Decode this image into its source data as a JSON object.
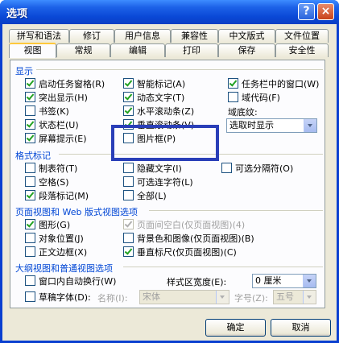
{
  "window": {
    "title": "选项",
    "help_label": "?",
    "close_label": "×"
  },
  "tabs_row1": [
    "拼写和语法",
    "修订",
    "用户信息",
    "兼容性",
    "中文版式",
    "文件位置"
  ],
  "tabs_row2": [
    "视图",
    "常规",
    "编辑",
    "打印",
    "保存",
    "安全性"
  ],
  "active_tab": "视图",
  "display": {
    "title": "显示",
    "items": [
      {
        "label": "启动任务窗格(R)",
        "checked": true
      },
      {
        "label": "智能标记(A)",
        "checked": true
      },
      {
        "label": "任务栏中的窗口(W)",
        "checked": true
      },
      {
        "label": "突出显示(H)",
        "checked": true
      },
      {
        "label": "动态文字(T)",
        "checked": true
      },
      {
        "label": "域代码(F)",
        "checked": false
      },
      {
        "label": "书签(K)",
        "checked": false
      },
      {
        "label": "水平滚动条(Z)",
        "checked": true
      },
      {
        "label": "状态栏(U)",
        "checked": true
      },
      {
        "label": "垂直滚动条(V)",
        "checked": true
      },
      {
        "label": "屏幕提示(E)",
        "checked": true
      },
      {
        "label": "图片框(P)",
        "checked": false
      }
    ],
    "field_shading_label": "域底纹:",
    "field_shading_value": "选取时显示"
  },
  "format": {
    "title": "格式标记",
    "items": [
      {
        "label": "制表符(T)",
        "checked": false
      },
      {
        "label": "隐藏文字(I)",
        "checked": false
      },
      {
        "label": "可选分隔符(O)",
        "checked": false
      },
      {
        "label": "空格(S)",
        "checked": false
      },
      {
        "label": "可选连字符(L)",
        "checked": false
      },
      {
        "label": "段落标记(M)",
        "checked": true
      },
      {
        "label": "全部(L)",
        "checked": false
      }
    ]
  },
  "print_view": {
    "title": "页面视图和 Web 版式视图选项",
    "items": [
      {
        "label": "图形(G)",
        "checked": true
      },
      {
        "label": "页面间空白(仅页面视图)(4)",
        "checked": true,
        "disabled": true
      },
      {
        "label": "对象位置(J)",
        "checked": false
      },
      {
        "label": "背景色和图像(仅页面视图)(B)",
        "checked": false
      },
      {
        "label": "正文边框(X)",
        "checked": false
      },
      {
        "label": "垂直标尺(仅页面视图)(C)",
        "checked": true
      }
    ]
  },
  "outline": {
    "title": "大纲视图和普通视图选项",
    "wrap_label": "窗口内自动换行(W)",
    "style_width_label": "样式区宽度(E):",
    "style_width_value": "0 厘米",
    "draft_label": "草稿字体(D):",
    "name_label": "名称(I):",
    "name_value": "宋体",
    "size_label": "字号(Z):",
    "size_value": "五号"
  },
  "buttons": {
    "ok": "确定",
    "cancel": "取消"
  }
}
